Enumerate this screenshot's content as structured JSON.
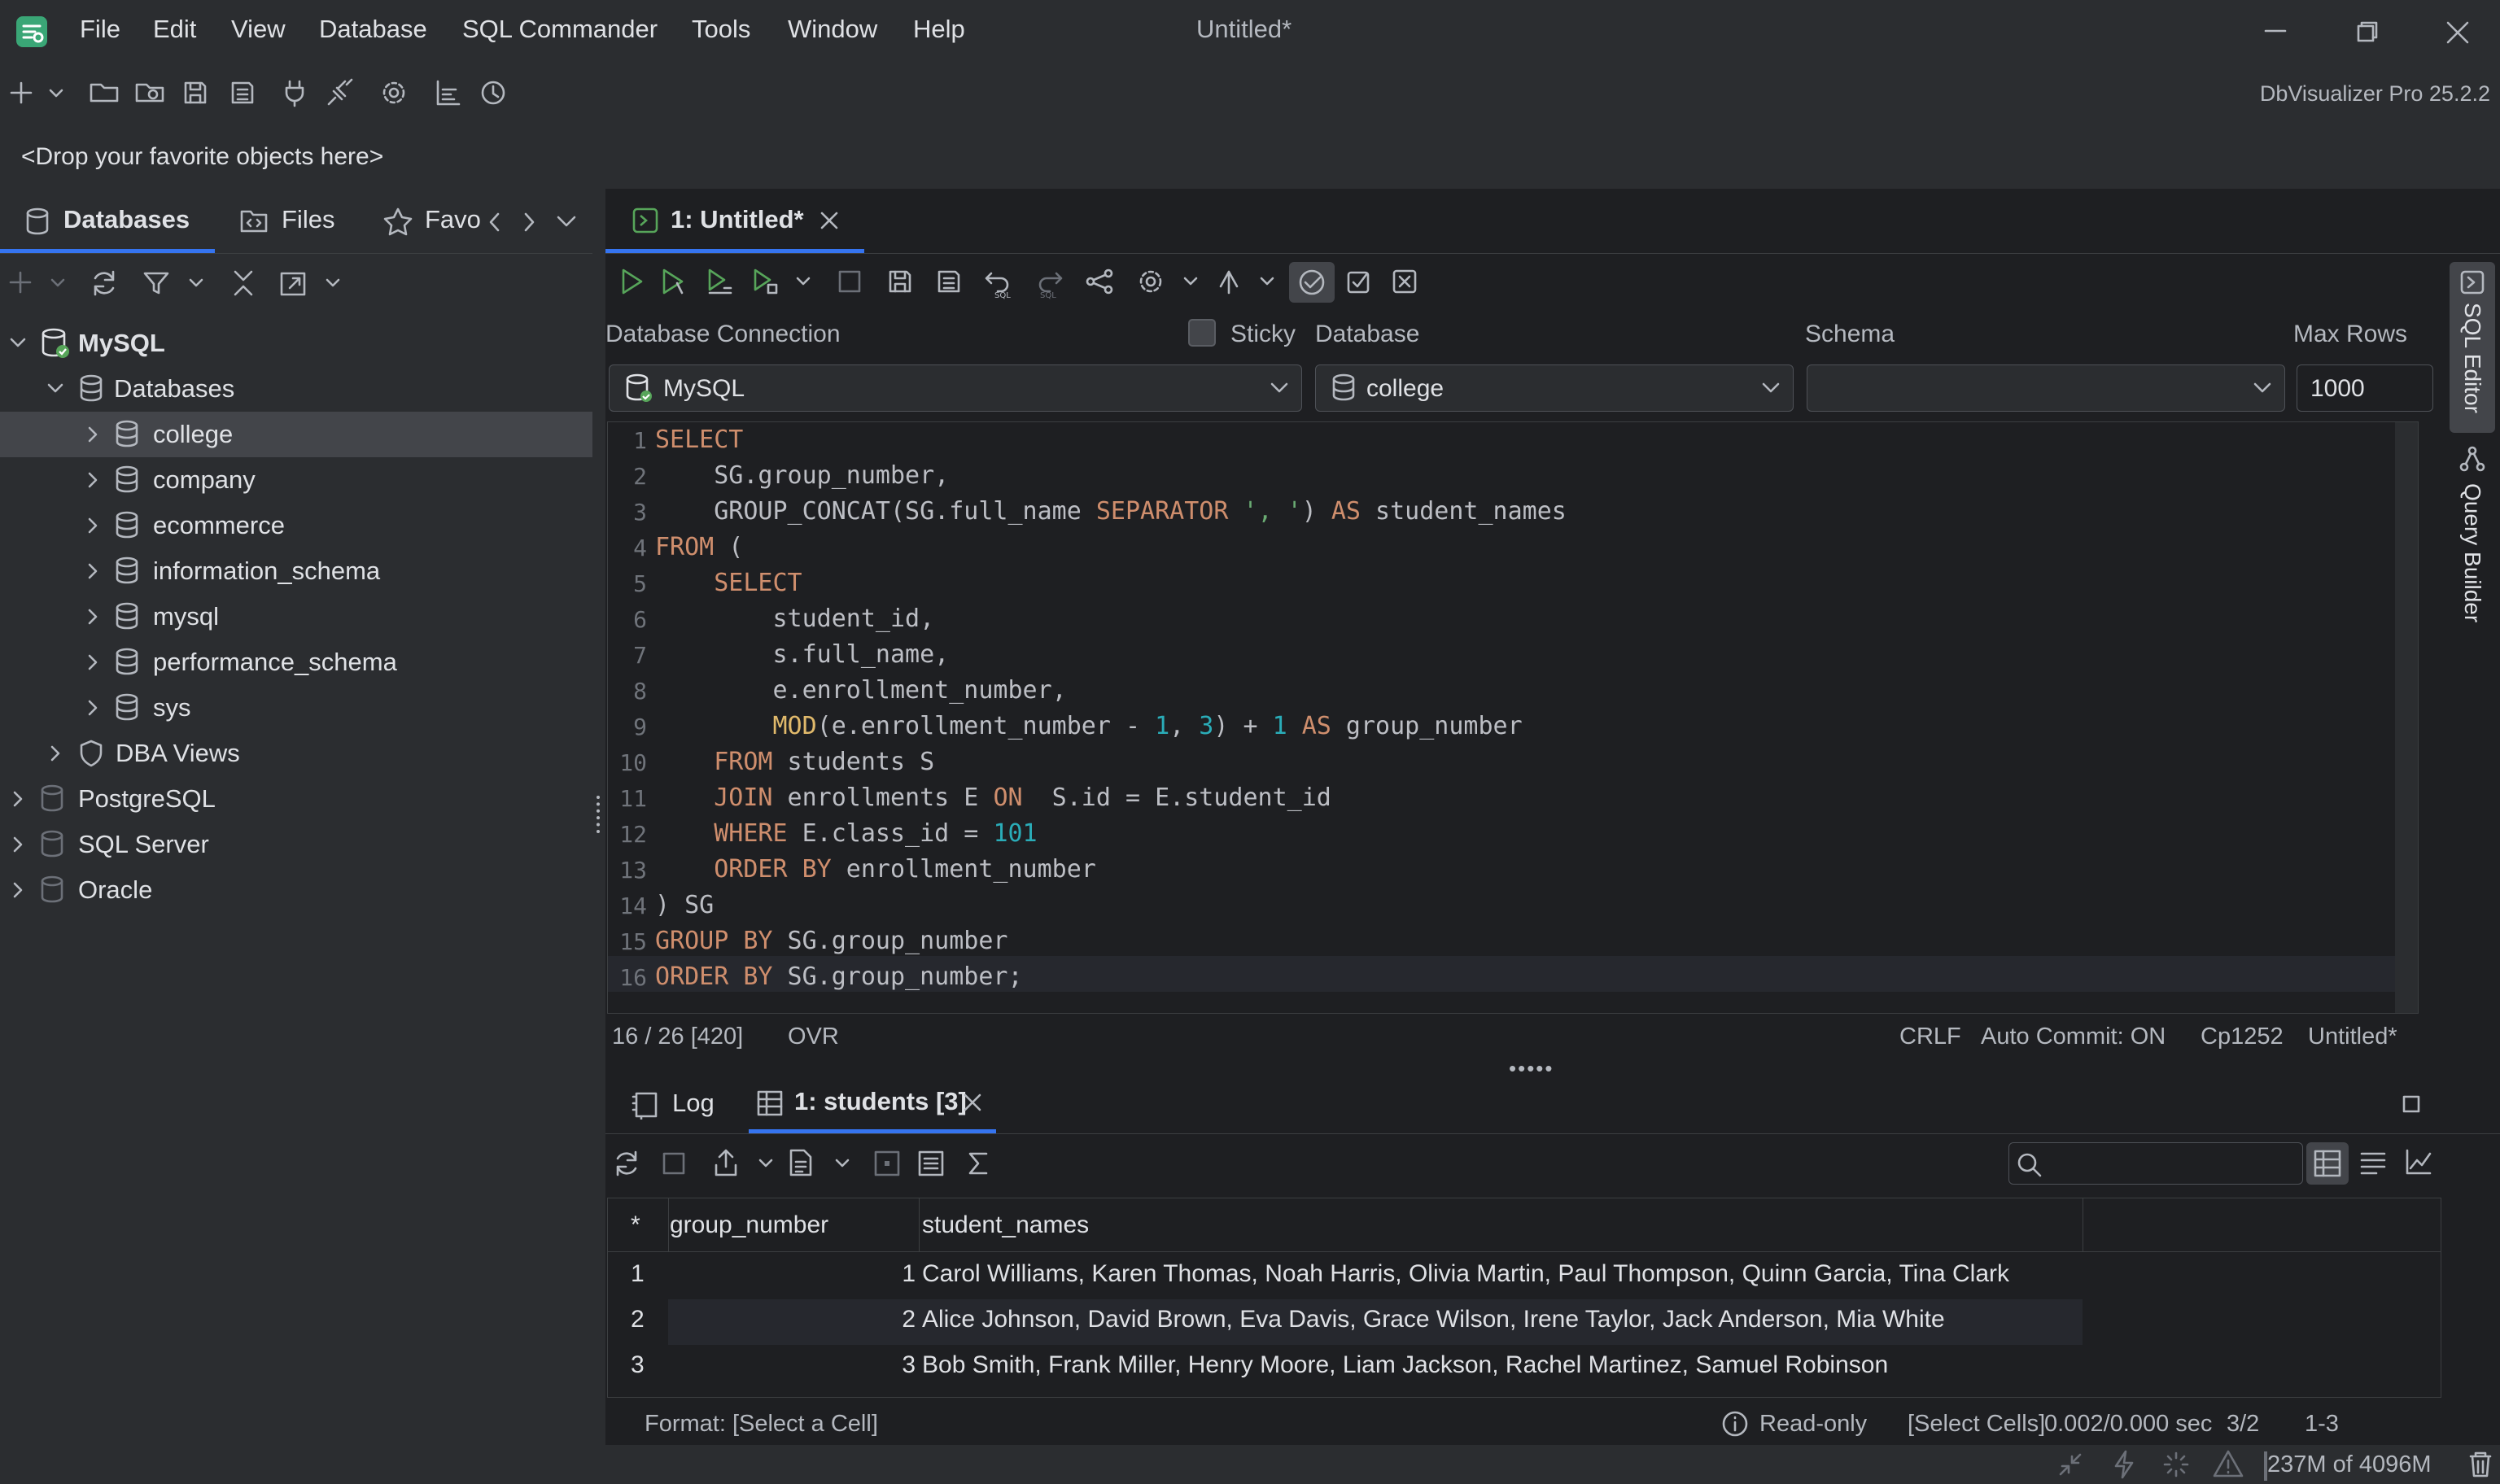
{
  "window": {
    "title": "Untitled*",
    "app_version": "DbVisualizer Pro 25.2.2"
  },
  "menu": [
    "File",
    "Edit",
    "View",
    "Database",
    "SQL Commander",
    "Tools",
    "Window",
    "Help"
  ],
  "dropzone": "<Drop your favorite objects here>",
  "left_tabs": {
    "databases": "Databases",
    "files": "Files",
    "favorites": "Favo"
  },
  "tree": {
    "root": "MySQL",
    "databases_node": "Databases",
    "dbs": [
      "college",
      "company",
      "ecommerce",
      "information_schema",
      "mysql",
      "performance_schema",
      "sys"
    ],
    "dba_views": "DBA Views",
    "others": [
      "PostgreSQL",
      "SQL Server",
      "Oracle"
    ]
  },
  "editor_tab": "1: Untitled*",
  "connection": {
    "db_connection_label": "Database Connection",
    "sticky_label": "Sticky",
    "database_label": "Database",
    "schema_label": "Schema",
    "maxrows_label": "Max Rows",
    "connection_value": "MySQL",
    "database_value": "college",
    "schema_value": "",
    "maxrows_value": "1000"
  },
  "side_tabs": {
    "sql_editor": "SQL Editor",
    "query_builder": "Query Builder"
  },
  "editor_status": {
    "position": "16 / 26  [420]",
    "mode": "OVR",
    "line_end": "CRLF",
    "auto_commit": "Auto Commit: ON",
    "encoding": "Cp1252",
    "file": "Untitled*"
  },
  "result_tabs": {
    "log": "Log",
    "students": "1: students [3]"
  },
  "grid": {
    "columns": [
      "*",
      "group_number",
      "student_names"
    ],
    "rows": [
      {
        "idx": "1",
        "group_number": "1",
        "student_names": "Carol Williams, Karen Thomas, Noah Harris, Olivia Martin, Paul Thompson, Quinn Garcia, Tina Clark"
      },
      {
        "idx": "2",
        "group_number": "2",
        "student_names": "Alice Johnson, David Brown, Eva Davis, Grace Wilson, Irene Taylor, Jack Anderson, Mia White"
      },
      {
        "idx": "3",
        "group_number": "3",
        "student_names": "Bob Smith, Frank Miller, Henry Moore, Liam Jackson, Rachel Martinez, Samuel Robinson"
      }
    ]
  },
  "result_status": {
    "format": "Format: [Select a Cell]",
    "readonly": "Read-only",
    "select_cells": "[Select Cells]",
    "timing": "0.002/0.000 sec",
    "pos": "3/2",
    "range": "1-3"
  },
  "memory": "237M of 4096M",
  "colors": {
    "accent": "#3574f0",
    "keyword": "#cf8e6d",
    "number": "#2aacb8",
    "string": "#6aab73",
    "function": "#e0b96b",
    "run_green": "#57a55a"
  }
}
